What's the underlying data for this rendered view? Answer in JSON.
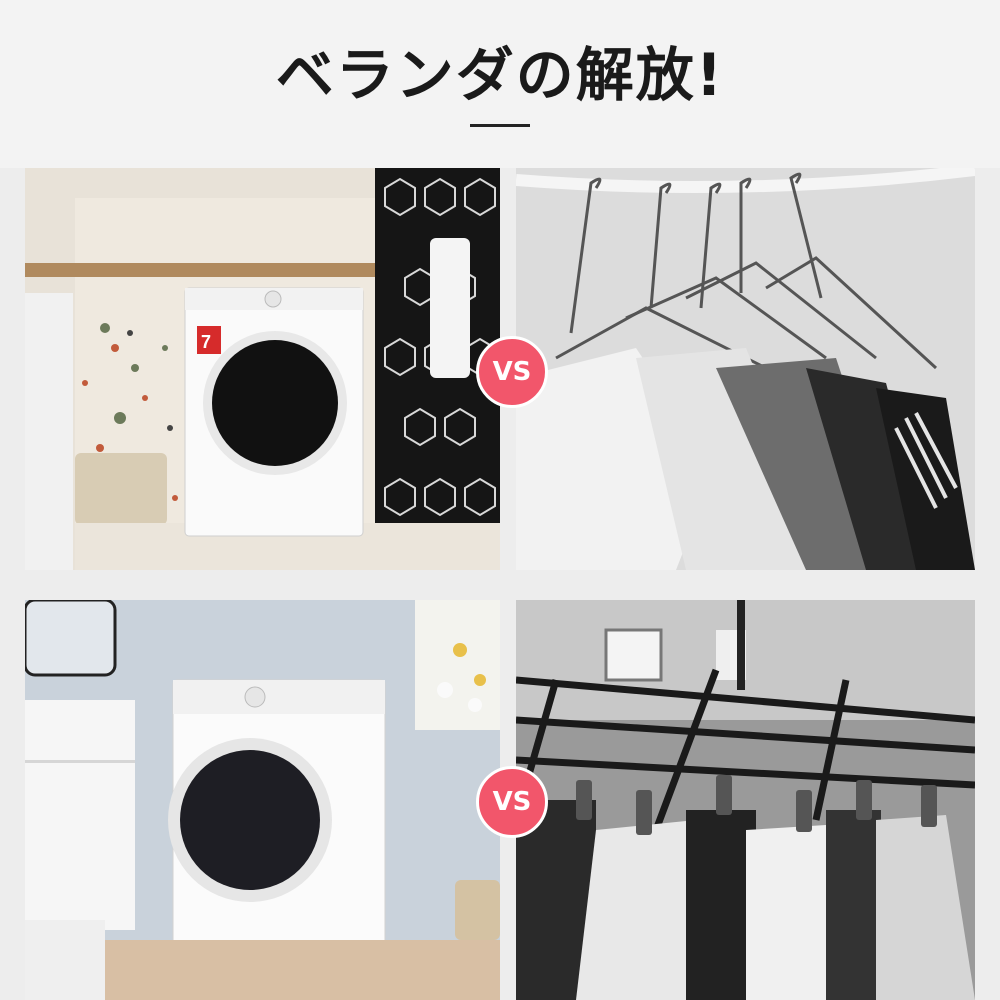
{
  "header": {
    "title": "ベランダの解放!"
  },
  "comparisons": [
    {
      "vs_label": "VS",
      "dryer_badge": "7"
    },
    {
      "vs_label": "VS"
    }
  ]
}
